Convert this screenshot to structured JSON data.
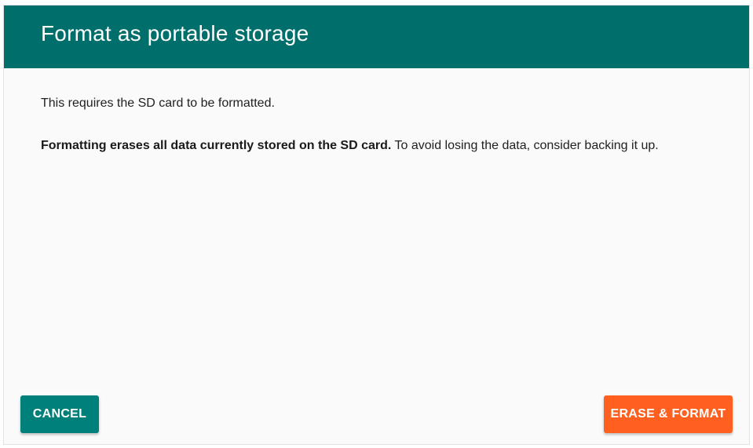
{
  "dialog": {
    "title": "Format as portable storage",
    "line1": "This requires the SD card to be formatted.",
    "line2_bold": "Formatting erases all data currently stored on the SD card.",
    "line2_rest": " To avoid losing the data, consider backing it up."
  },
  "actions": {
    "cancel_label": "CANCEL",
    "erase_label": "ERASE & FORMAT"
  },
  "colors": {
    "header": "#006e6a",
    "cancel_button": "#00807a",
    "erase_button": "#ff5f1f",
    "background": "#fafafa"
  }
}
